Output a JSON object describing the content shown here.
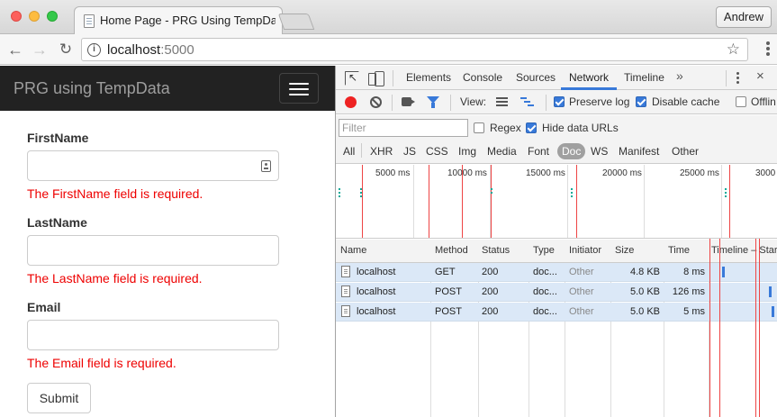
{
  "browser": {
    "tab_title": "Home Page - PRG Using TempData",
    "profile_name": "Andrew",
    "url_host": "localhost",
    "url_port": ":5000"
  },
  "page": {
    "brand": "PRG using TempData",
    "fields": [
      {
        "label": "FirstName",
        "value": "",
        "error": "The FirstName field is required."
      },
      {
        "label": "LastName",
        "value": "",
        "error": "The LastName field is required."
      },
      {
        "label": "Email",
        "value": "",
        "error": "The Email field is required."
      }
    ],
    "submit_label": "Submit"
  },
  "devtools": {
    "tabs": [
      "Elements",
      "Console",
      "Sources",
      "Network",
      "Timeline"
    ],
    "active_tab": "Network",
    "more_tabs": "»",
    "close": "×",
    "view_label": "View:",
    "preserve_log": {
      "label": "Preserve log",
      "checked": true
    },
    "disable_cache": {
      "label": "Disable cache",
      "checked": true
    },
    "offline": {
      "label": "Offlin",
      "checked": false
    },
    "filter_placeholder": "Filter",
    "regex": {
      "label": "Regex",
      "checked": false
    },
    "hide_data_urls": {
      "label": "Hide data URLs",
      "checked": true
    },
    "types": [
      "All",
      "XHR",
      "JS",
      "CSS",
      "Img",
      "Media",
      "Font",
      "Doc",
      "WS",
      "Manifest",
      "Other"
    ],
    "active_type": "Doc",
    "overview_ticks": [
      "5000 ms",
      "10000 ms",
      "15000 ms",
      "20000 ms",
      "25000 ms",
      "3000"
    ],
    "columns": [
      "Name",
      "Method",
      "Status",
      "Type",
      "Initiator",
      "Size",
      "Time",
      "Timeline – Start"
    ],
    "requests": [
      {
        "name": "localhost",
        "method": "GET",
        "status": "200",
        "type": "doc...",
        "initiator": "Other",
        "size": "4.8 KB",
        "time": "8 ms"
      },
      {
        "name": "localhost",
        "method": "POST",
        "status": "200",
        "type": "doc...",
        "initiator": "Other",
        "size": "5.0 KB",
        "time": "126 ms"
      },
      {
        "name": "localhost",
        "method": "POST",
        "status": "200",
        "type": "doc...",
        "initiator": "Other",
        "size": "5.0 KB",
        "time": "5 ms"
      }
    ]
  },
  "colors": {
    "accent": "#3879d9",
    "error": "#e00000",
    "navbar": "#222222",
    "row_selected": "#dbe8f7"
  }
}
